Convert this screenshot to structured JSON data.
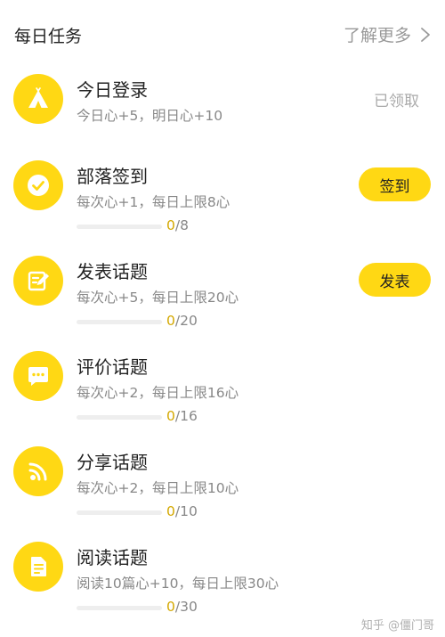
{
  "header": {
    "title": "每日任务",
    "more_label": "了解更多"
  },
  "tasks": [
    {
      "title": "今日登录",
      "desc": "今日心+5，明日心+10",
      "icon": "tent-icon",
      "status_label": "已领取"
    },
    {
      "title": "部落签到",
      "desc": "每次心+1，每日上限8心",
      "icon": "check-circle-icon",
      "action_label": "签到",
      "progress_current": "0",
      "progress_total": "/8",
      "progress_fraction": 0
    },
    {
      "title": "发表话题",
      "desc": "每次心+5，每日上限20心",
      "icon": "edit-icon",
      "action_label": "发表",
      "progress_current": "0",
      "progress_total": "/20",
      "progress_fraction": 0
    },
    {
      "title": "评价话题",
      "desc": "每次心+2，每日上限16心",
      "icon": "chat-bubble-icon",
      "progress_current": "0",
      "progress_total": "/16",
      "progress_fraction": 0
    },
    {
      "title": "分享话题",
      "desc": "每次心+2，每日上限10心",
      "icon": "share-feed-icon",
      "progress_current": "0",
      "progress_total": "/10",
      "progress_fraction": 0
    },
    {
      "title": "阅读话题",
      "desc": "阅读10篇心+10，每日上限30心",
      "icon": "document-icon",
      "progress_current": "0",
      "progress_total": "/30",
      "progress_fraction": 0
    }
  ],
  "watermark": "知乎 @僵门哥",
  "colors": {
    "accent": "#ffd814",
    "progress_current": "#d4a800",
    "muted_text": "#888888"
  }
}
